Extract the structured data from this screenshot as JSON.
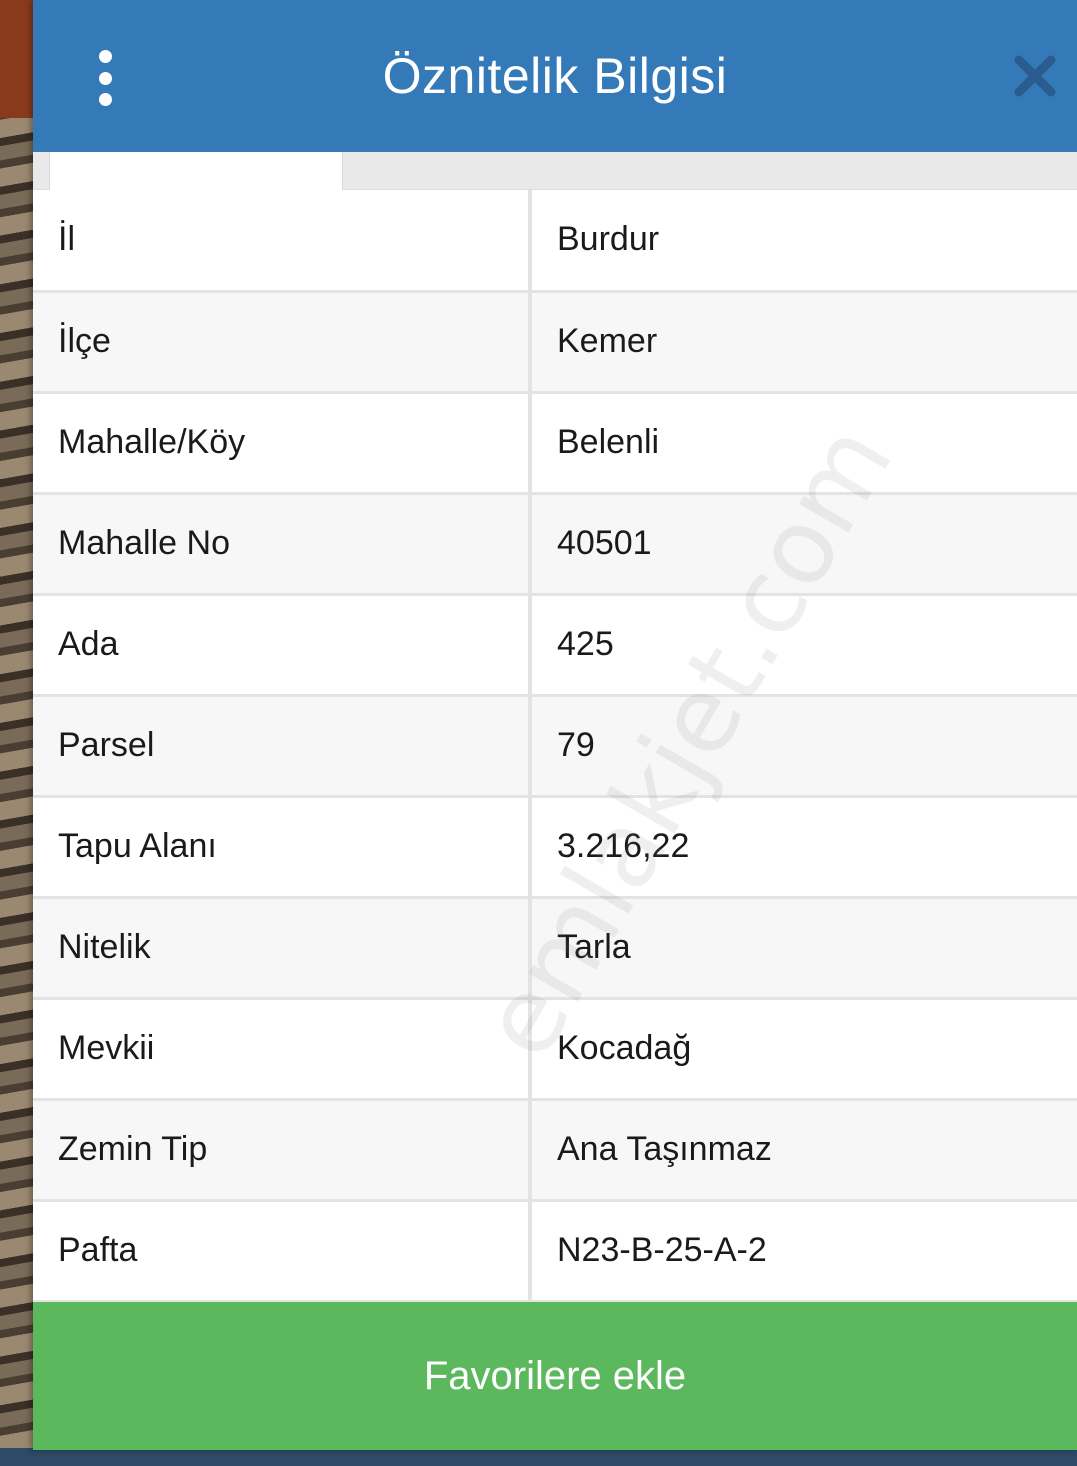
{
  "header": {
    "title": "Öznitelik Bilgisi"
  },
  "rows": [
    {
      "key": "İl",
      "value": "Burdur"
    },
    {
      "key": "İlçe",
      "value": "Kemer"
    },
    {
      "key": "Mahalle/Köy",
      "value": "Belenli"
    },
    {
      "key": "Mahalle No",
      "value": "40501"
    },
    {
      "key": "Ada",
      "value": "425"
    },
    {
      "key": "Parsel",
      "value": "79"
    },
    {
      "key": "Tapu Alanı",
      "value": "3.216,22"
    },
    {
      "key": "Nitelik",
      "value": "Tarla"
    },
    {
      "key": "Mevkii",
      "value": "Kocadağ"
    },
    {
      "key": "Zemin Tip",
      "value": "Ana Taşınmaz"
    },
    {
      "key": "Pafta",
      "value": "N23-B-25-A-2"
    }
  ],
  "footer": {
    "favorite_label": "Favorilere ekle"
  },
  "watermark": "emlakjet.com",
  "colors": {
    "header": "#347ab8",
    "button": "#5cb85c"
  },
  "icons": {
    "menu": "kebab-menu-icon",
    "close": "close-icon"
  }
}
